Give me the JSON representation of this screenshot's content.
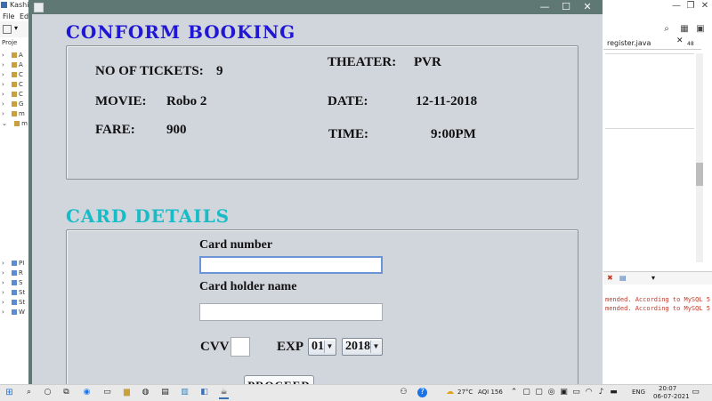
{
  "ide": {
    "title": "Kashi",
    "menu": [
      "File",
      "Ed"
    ],
    "project_tab": "Proje",
    "tree_items": [
      "A",
      "A",
      "C",
      "C",
      "C",
      "G",
      "m",
      "m",
      "",
      "",
      "",
      "",
      "",
      "PI",
      "R",
      "S",
      "St",
      "St",
      "W"
    ],
    "editor_tab": "register.java",
    "editor_tab_count": "48",
    "console_lines": [
      "mended. According to MySQL 5",
      "mended. According to MySQL 5"
    ]
  },
  "window": {
    "minimize": "—",
    "maximize": "☐",
    "close": "✕"
  },
  "booking": {
    "title": "CONFORM BOOKING",
    "tickets_label": "NO OF TICKETS:",
    "tickets_value": "9",
    "theater_label": "THEATER:",
    "theater_value": "PVR",
    "movie_label": "MOVIE:",
    "movie_value": "Robo 2",
    "date_label": "DATE:",
    "date_value": "12-11-2018",
    "fare_label": "FARE:",
    "fare_value": "900",
    "time_label": "TIME:",
    "time_value": "9:00PM"
  },
  "card": {
    "title": "CARD DETAILS",
    "number_label": "Card number",
    "number_value": "",
    "holder_label": "Card holder name",
    "holder_value": "",
    "cvv_label": "CVV",
    "cvv_value": "",
    "exp_label": "EXP",
    "exp_month": "01",
    "exp_year": "2018",
    "proceed_label": "PROCEED"
  },
  "taskbar": {
    "temperature": "27°C",
    "aqi": "AQI 156",
    "language": "ENG",
    "time": "20:07",
    "date": "06-07-2021"
  },
  "colors": {
    "booking_title": "#1f16d6",
    "card_title": "#17bcc6",
    "window_bg": "#d1d5dc",
    "titlebar": "#5f7873"
  }
}
